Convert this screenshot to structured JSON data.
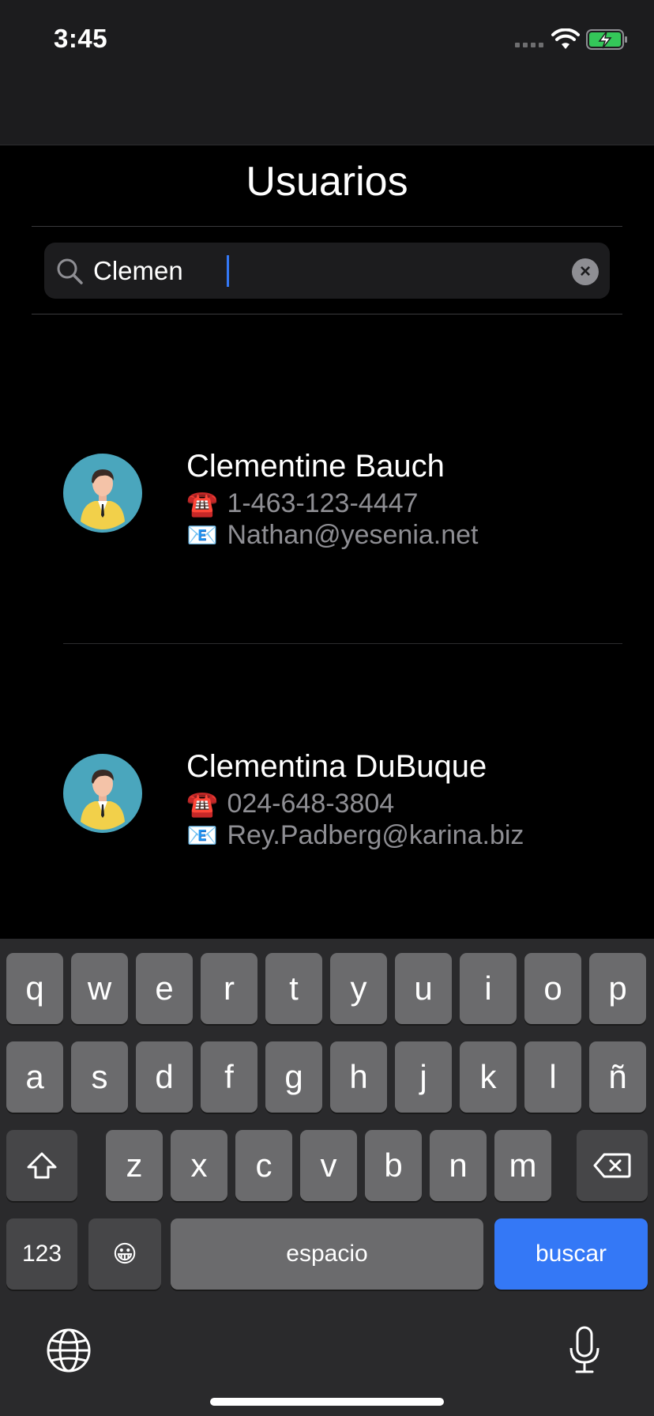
{
  "status": {
    "time": "3:45"
  },
  "header": {
    "title": "Usuarios"
  },
  "search": {
    "value": "Clemen",
    "placeholder": ""
  },
  "users": [
    {
      "name": "Clementine Bauch",
      "phone_icon": "☎️",
      "phone": "1-463-123-4447",
      "email_icon": "📧",
      "email": "Nathan@yesenia.net"
    },
    {
      "name": "Clementina DuBuque",
      "phone_icon": "☎️",
      "phone": "024-648-3804",
      "email_icon": "📧",
      "email": "Rey.Padberg@karina.biz"
    }
  ],
  "keyboard": {
    "row1": [
      "q",
      "w",
      "e",
      "r",
      "t",
      "y",
      "u",
      "i",
      "o",
      "p"
    ],
    "row2": [
      "a",
      "s",
      "d",
      "f",
      "g",
      "h",
      "j",
      "k",
      "l",
      "ñ"
    ],
    "row3": [
      "z",
      "x",
      "c",
      "v",
      "b",
      "n",
      "m"
    ],
    "numbers_key": "123",
    "emoji_key": "😀",
    "space_key": "espacio",
    "action_key": "buscar"
  },
  "colors": {
    "accent": "#3478f6",
    "background": "#000000",
    "keyboard_bg": "#2a2a2c",
    "avatar_bg": "#4aa6bd"
  },
  "icons": [
    "search-icon",
    "clear-icon",
    "wifi-icon",
    "battery-icon",
    "shift-icon",
    "delete-icon",
    "globe-icon",
    "microphone-icon",
    "avatar-icon"
  ]
}
